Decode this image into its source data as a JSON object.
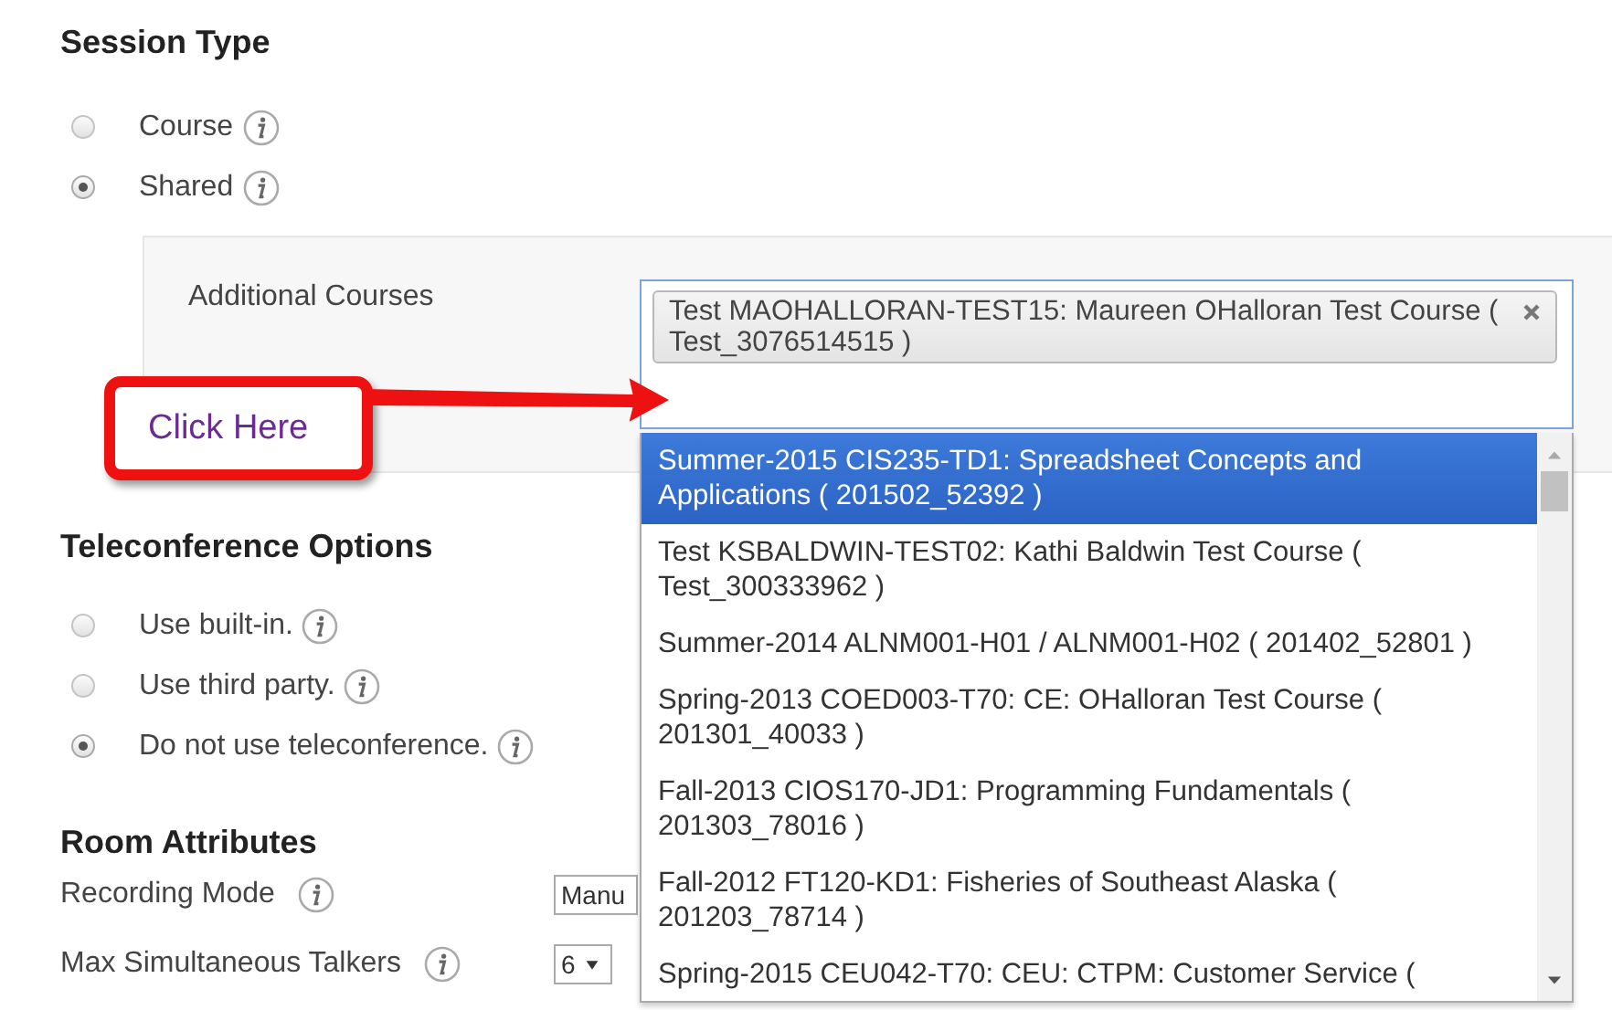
{
  "session_type": {
    "title": "Session Type",
    "options": [
      {
        "label": "Course",
        "selected": false
      },
      {
        "label": "Shared",
        "selected": true
      }
    ]
  },
  "additional_courses": {
    "label": "Additional Courses",
    "chips": [
      "Test MAOHALLORAN-TEST15: Maureen OHalloran Test Course ( Test_3076514515 )"
    ],
    "options": [
      {
        "label": "Summer-2015 CIS235-TD1: Spreadsheet Concepts and Applications ( 201502_52392 )",
        "selected": true
      },
      {
        "label": "Test KSBALDWIN-TEST02: Kathi Baldwin Test Course ( Test_300333962 )",
        "selected": false
      },
      {
        "label": "Summer-2014 ALNM001-H01 / ALNM001-H02 ( 201402_52801 )",
        "selected": false
      },
      {
        "label": "Spring-2013 COED003-T70: CE: OHalloran Test Course ( 201301_40033 )",
        "selected": false
      },
      {
        "label": "Fall-2013 CIOS170-JD1: Programming Fundamentals ( 201303_78016 )",
        "selected": false
      },
      {
        "label": "Fall-2012 FT120-KD1: Fisheries of Southeast Alaska ( 201203_78714 )",
        "selected": false
      },
      {
        "label": "Spring-2015 CEU042-T70: CEU: CTPM: Customer Service (",
        "selected": false
      }
    ]
  },
  "callout": {
    "text": "Click Here"
  },
  "teleconference": {
    "title": "Teleconference Options",
    "options": [
      {
        "label": "Use built-in.",
        "selected": false
      },
      {
        "label": "Use third party.",
        "selected": false
      },
      {
        "label": "Do not use teleconference.",
        "selected": true
      }
    ]
  },
  "room_attributes": {
    "title": "Room Attributes",
    "fields": [
      {
        "label": "Recording Mode",
        "value": "Manu",
        "kind": "text"
      },
      {
        "label": "Max Simultaneous Talkers",
        "value": "6",
        "kind": "select"
      }
    ]
  }
}
